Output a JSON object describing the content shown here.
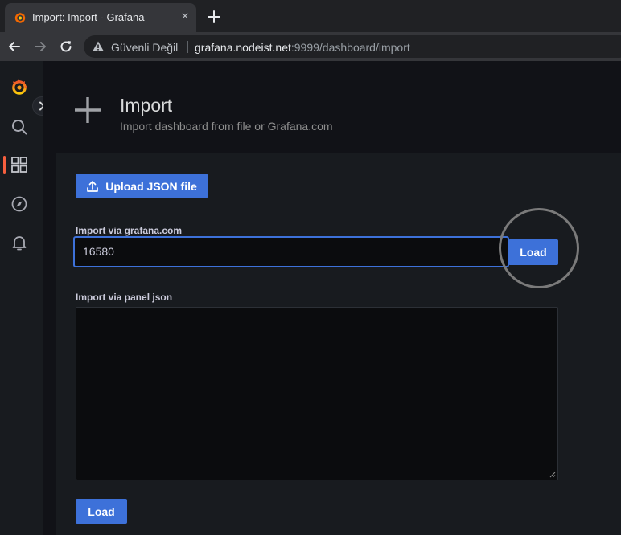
{
  "browser": {
    "tab_title": "Import: Import - Grafana",
    "tab_close": "×",
    "security_text": "Güvenli Değil",
    "url_host": "grafana.nodeist.net",
    "url_rest": ":9999/dashboard/import"
  },
  "sidemenu": {
    "items": [
      {
        "icon": "grafana-logo-icon"
      },
      {
        "icon": "search-icon"
      },
      {
        "icon": "dashboards-icon",
        "active": true
      },
      {
        "icon": "explore-compass-icon"
      },
      {
        "icon": "alerting-bell-icon"
      }
    ],
    "accent_color": "#f55f3e"
  },
  "page": {
    "title": "Import",
    "subtitle": "Import dashboard from file or Grafana.com"
  },
  "import": {
    "upload_label": "Upload JSON file",
    "grafana_com_label": "Import via grafana.com",
    "grafana_com_value": "16580",
    "load_label": "Load",
    "panel_json_label": "Import via panel json",
    "panel_json_value": "",
    "load_bottom_label": "Load"
  },
  "colors": {
    "primary": "#3d71d9",
    "background": "#111217",
    "panel": "#181b1f"
  }
}
